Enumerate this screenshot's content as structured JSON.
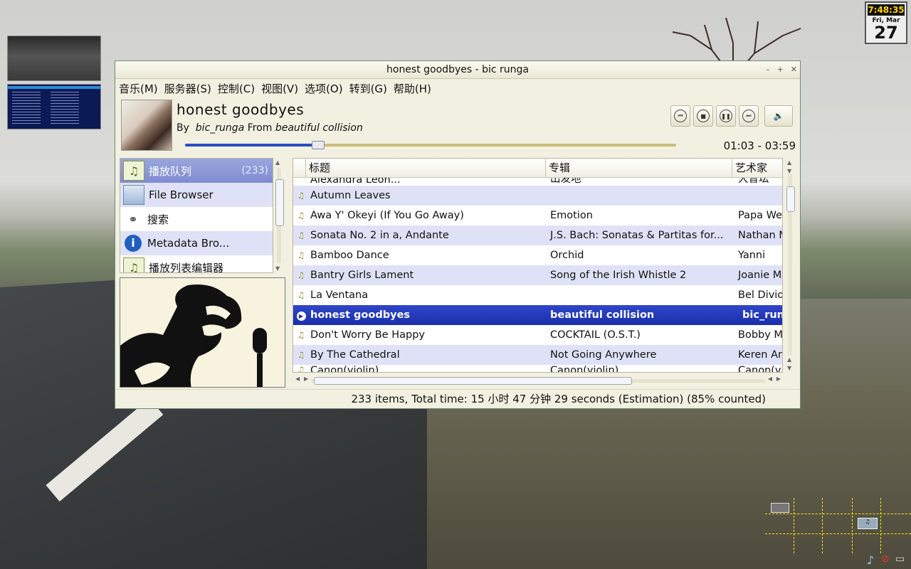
{
  "window": {
    "title": "honest goodbyes -  bic runga",
    "minimize_icon": "minimize-icon",
    "maximize_icon": "maximize-icon",
    "close_icon": "close-icon"
  },
  "menu": [
    "音乐(M)",
    "服务器(S)",
    "控制(C)",
    "视图(V)",
    "选项(O)",
    "转到(G)",
    "帮助(H)"
  ],
  "now_playing": {
    "title": "honest goodbyes",
    "by_label": "By",
    "artist": "bic_runga",
    "from_label": "From",
    "album": "beautiful collision",
    "time": "01:03 - 03:59",
    "progress": 0.27
  },
  "controls": {
    "previous_icon": "previous-icon",
    "stop_icon": "stop-icon",
    "pause_icon": "pause-icon",
    "next_icon": "next-icon",
    "volume_icon": "volume-icon"
  },
  "sidebar": {
    "items": [
      {
        "label": "播放队列",
        "count": "(233)",
        "icon": "playlist-icon"
      },
      {
        "label": "File Browser",
        "count": "",
        "icon": "folder-icon"
      },
      {
        "label": "搜索",
        "count": "",
        "icon": "binoculars-icon"
      },
      {
        "label": "Metadata Bro...",
        "count": "",
        "icon": "info-icon"
      },
      {
        "label": "播放列表编辑器",
        "count": "",
        "icon": "playlist-editor-icon"
      }
    ]
  },
  "playlist": {
    "columns": [
      "标题",
      "专辑",
      "艺术家"
    ],
    "rows_partial_top": {
      "title": "Alexandra Leon...",
      "album": "出发地",
      "artist": "大音坛"
    },
    "rows": [
      {
        "title": "Autumn Leaves",
        "album": "",
        "artist": ""
      },
      {
        "title": "Awa Y' Okeyi (If You Go Away)",
        "album": "Emotion",
        "artist": "Papa Wemba"
      },
      {
        "title": "Sonata No. 2 in a, Andante",
        "album": "J.S. Bach:  Sonatas & Partitas for...",
        "artist": "Nathan Milstein"
      },
      {
        "title": "Bamboo Dance",
        "album": "Orchid",
        "artist": "Yanni"
      },
      {
        "title": "Bantry Girls Lament",
        "album": "Song of the Irish Whistle 2",
        "artist": "Joanie Madden"
      },
      {
        "title": "La Ventana",
        "album": "",
        "artist": "Bel Diviolin"
      },
      {
        "title": "honest goodbyes",
        "album": "beautiful collision",
        "artist": "bic_runga",
        "current": true
      },
      {
        "title": "Don't Worry Be Happy",
        "album": "COCKTAIL (O.S.T.)",
        "artist": "Bobby McFerrin"
      },
      {
        "title": "By The Cathedral",
        "album": "Not Going Anywhere",
        "artist": "Keren Ann"
      }
    ],
    "rows_partial_bottom": {
      "title": "Canon(violin)",
      "album": "Canon(violin)",
      "artist": "Canon(violin)"
    }
  },
  "status": "233 items,  Total time: 15 小时 47 分钟 29 seconds (Estimation) (85% counted)",
  "clock": {
    "time": "7:48:35",
    "date": "Fri, Mar",
    "day": "27"
  },
  "colors": {
    "selection": "#1a2faa",
    "alt_row": "#dfe2f6",
    "window_bg": "#f2f0e0"
  }
}
